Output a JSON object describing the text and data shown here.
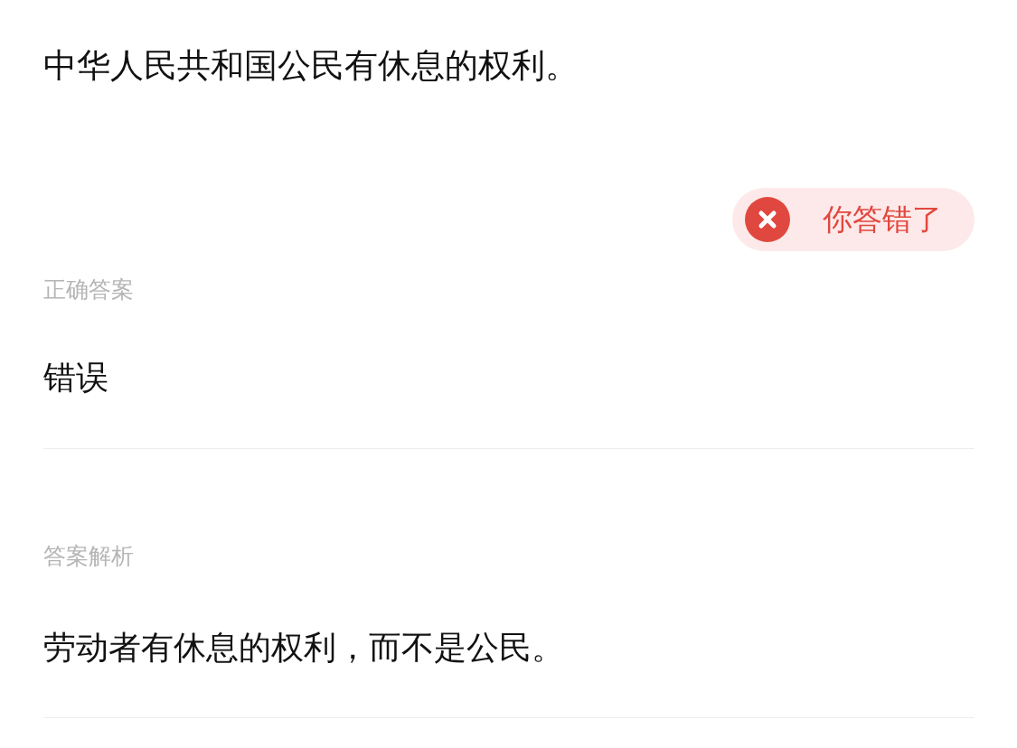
{
  "question": "中华人民共和国公民有休息的权利。",
  "result": {
    "kind": "wrong",
    "text": "你答错了"
  },
  "correct_answer": {
    "label": "正确答案",
    "value": "错误"
  },
  "explanation": {
    "label": "答案解析",
    "text": "劳动者有休息的权利，而不是公民。"
  }
}
